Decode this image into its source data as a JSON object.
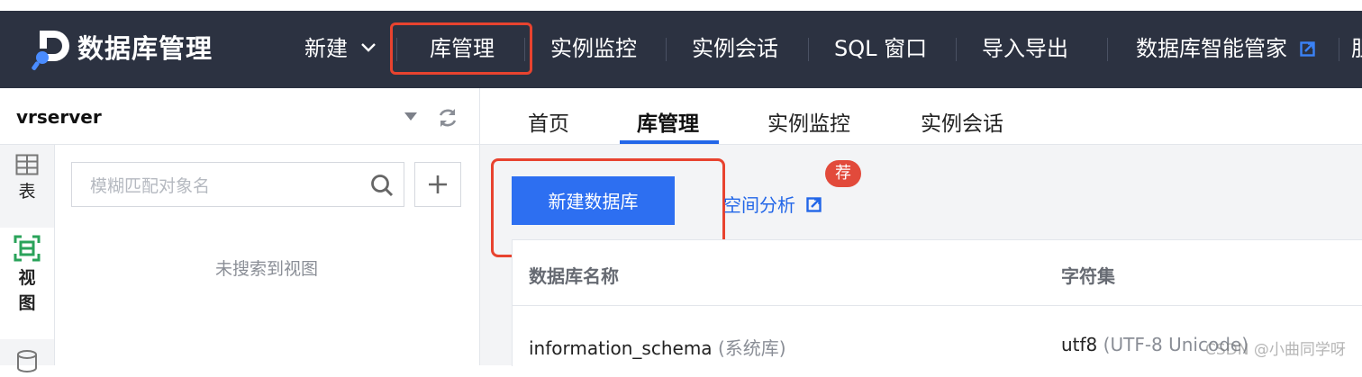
{
  "app": {
    "title": "数据库管理"
  },
  "nav": {
    "new": "新建",
    "items": [
      "库管理",
      "实例监控",
      "实例会话",
      "SQL 窗口",
      "导入导出",
      "数据库智能管家"
    ],
    "cut_off": "胆"
  },
  "sidebar": {
    "instance": "vrserver",
    "tabs": [
      "表",
      "视",
      "图"
    ],
    "search_placeholder": "模糊匹配对象名",
    "empty_text": "未搜索到视图"
  },
  "main": {
    "tabs": [
      "首页",
      "库管理",
      "实例监控",
      "实例会话"
    ],
    "active_tab": "库管理",
    "new_db_button": "新建数据库",
    "space_link": "空间分析",
    "badge": "荐",
    "table": {
      "headers": [
        "数据库名称",
        "字符集"
      ],
      "rows": [
        {
          "name": "information_schema",
          "tag": "(系统库)",
          "charset": "utf8",
          "charset_desc": "(UTF-8 Unicode)"
        }
      ]
    }
  },
  "watermark": "CSDN @小曲同学呀",
  "colors": {
    "topbar": "#2c3241",
    "primary": "#2d6ff1",
    "highlight": "#e8432f",
    "badge": "#e24a3b"
  }
}
